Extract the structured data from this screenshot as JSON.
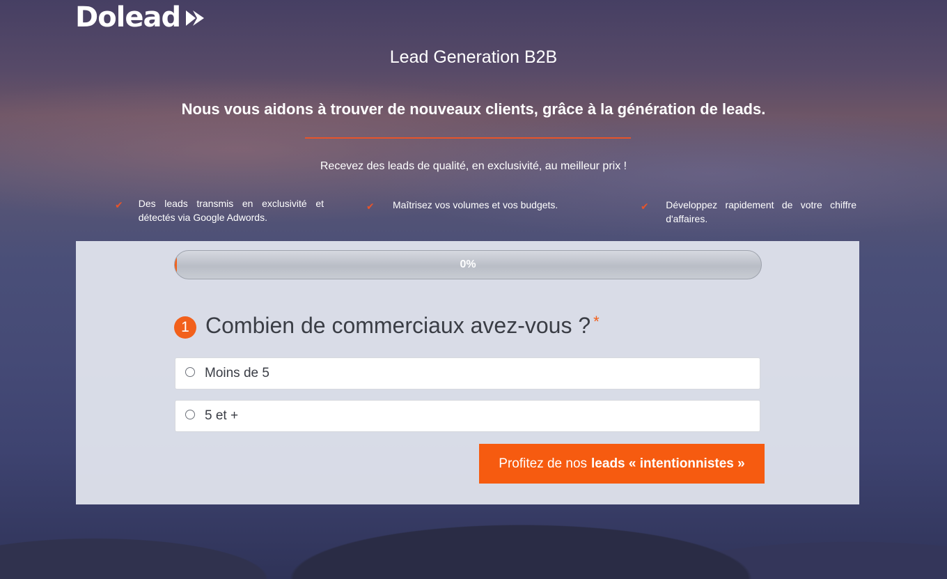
{
  "brand": {
    "name": "Dolead"
  },
  "header": {
    "tagline": "Lead Generation B2B",
    "headline": "Nous vous aidons à trouver de nouveaux clients, grâce à la génération de leads.",
    "subline": "Recevez des leads de qualité, en exclusivité, au meilleur prix !"
  },
  "features": [
    {
      "icon": "check-icon",
      "text": "Des leads transmis en exclusivité et détectés via Google Adwords."
    },
    {
      "icon": "check-icon",
      "text": "Maîtrisez vos volumes et vos budgets."
    },
    {
      "icon": "check-icon",
      "text": "Développez rapidement de votre chiffre d'affaires."
    }
  ],
  "form": {
    "progress": {
      "value": 0,
      "label": "0%"
    },
    "question": {
      "number": "1",
      "text": "Combien de commerciaux avez-vous ?",
      "required_mark": "*"
    },
    "options": [
      {
        "label": "Moins de 5",
        "selected": false
      },
      {
        "label": "5 et +",
        "selected": false
      }
    ],
    "cta": {
      "prefix": "Profitez de nos",
      "emphasis": "leads « intentionnistes »"
    }
  },
  "colors": {
    "accent": "#f65b10",
    "divider": "#e8542a",
    "panel": "#e4e7f0",
    "question_text": "#3a3d45"
  }
}
